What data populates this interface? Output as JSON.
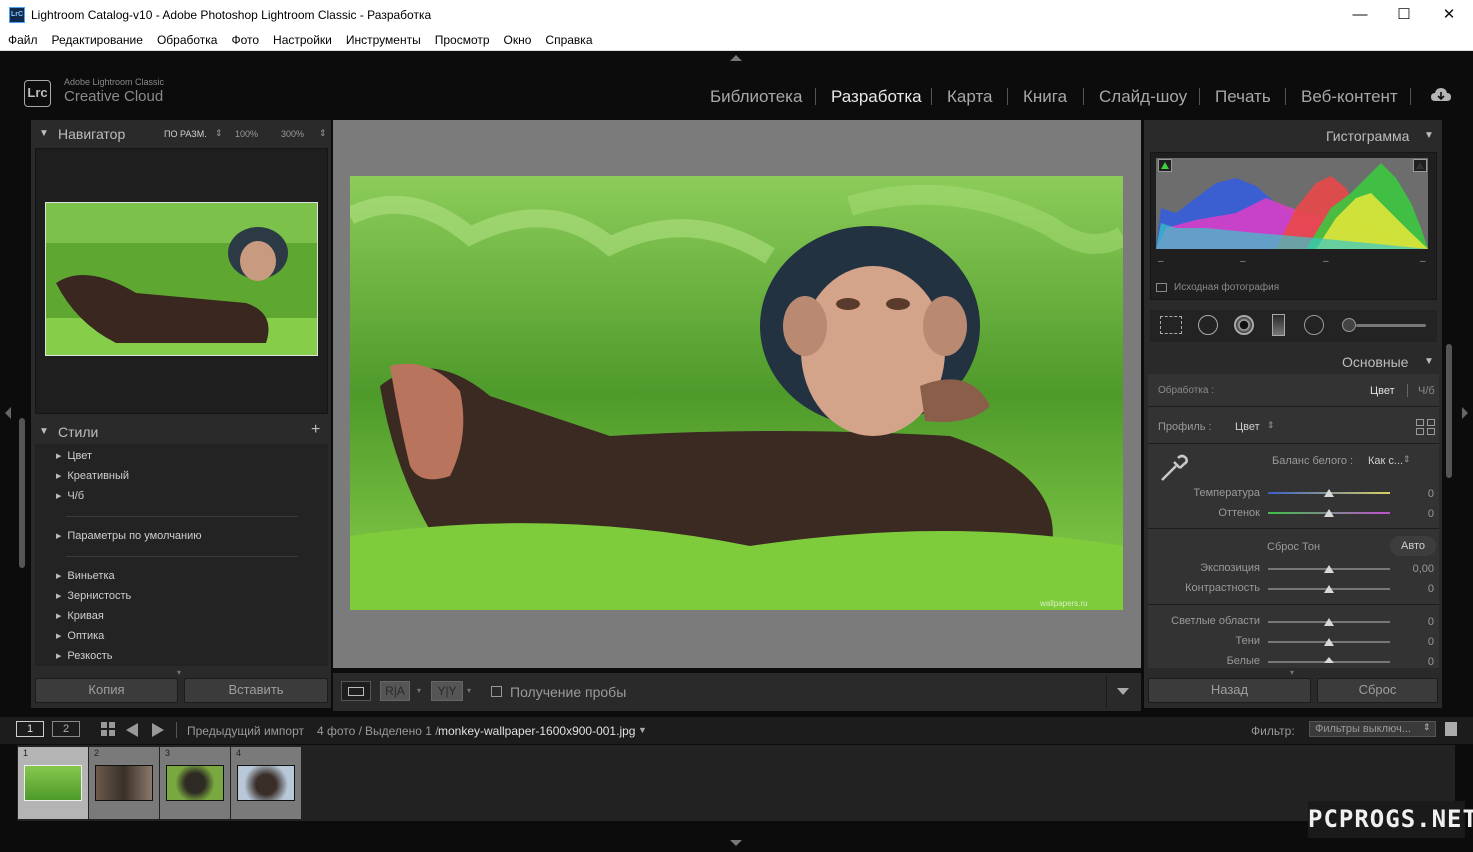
{
  "window": {
    "title": "Lightroom Catalog-v10 - Adobe Photoshop Lightroom Classic - Разработка",
    "app_icon_text": "LrC",
    "minimize_glyph": "—",
    "maximize_glyph": "☐",
    "close_glyph": "✕"
  },
  "menu": [
    "Файл",
    "Редактирование",
    "Обработка",
    "Фото",
    "Настройки",
    "Инструменты",
    "Просмотр",
    "Окно",
    "Справка"
  ],
  "brand": {
    "logo": "Lrc",
    "line1": "Adobe Lightroom Classic",
    "line2": "Creative Cloud"
  },
  "modules": {
    "items": [
      "Библиотека",
      "Разработка",
      "Карта",
      "Книга",
      "Слайд-шоу",
      "Печать",
      "Веб-контент"
    ],
    "active": "Разработка"
  },
  "navigator": {
    "title": "Навигатор",
    "fit": "ПО РАЗМ.",
    "zoom1": "100%",
    "zoom2": "300%"
  },
  "styles": {
    "title": "Стили",
    "group1": [
      "Цвет",
      "Креативный",
      "Ч/б"
    ],
    "group2": [
      "Параметры по умолчанию"
    ],
    "group3": [
      "Виньетка",
      "Зернистость",
      "Кривая",
      "Оптика",
      "Резкость"
    ]
  },
  "left_buttons": {
    "copy": "Копия",
    "paste": "Вставить"
  },
  "toolbar": {
    "soft_proof": "Получение пробы",
    "ra": "R|A",
    "yy": "Y|Y"
  },
  "photo": {
    "watermark": "wallpapers.ru"
  },
  "histogram": {
    "title": "Гистограмма",
    "original_photo": "Исходная фотография",
    "ticks": [
      "–",
      "–",
      "–",
      "–"
    ]
  },
  "basic": {
    "title": "Основные",
    "treatment_label": "Обработка :",
    "treatment_color": "Цвет",
    "treatment_bw": "Ч/б",
    "profile_label": "Профиль :",
    "profile_value": "Цвет",
    "wb_label": "Баланс белого :",
    "wb_value": "Как с...",
    "tone_label": "Сброс Тон",
    "auto_label": "Авто",
    "sliders": [
      {
        "label": "Температура",
        "value": "0",
        "pos": 0.5
      },
      {
        "label": "Оттенок",
        "value": "0",
        "pos": 0.5
      },
      {
        "label": "Экспозиция",
        "value": "0,00",
        "pos": 0.5
      },
      {
        "label": "Контрастность",
        "value": "0",
        "pos": 0.5
      },
      {
        "label": "Светлые области",
        "value": "0",
        "pos": 0.5
      },
      {
        "label": "Тени",
        "value": "0",
        "pos": 0.5
      },
      {
        "label": "Белые",
        "value": "0",
        "pos": 0.5
      }
    ]
  },
  "right_buttons": {
    "previous": "Назад",
    "reset": "Сброс"
  },
  "filmstrip_bar": {
    "screen1": "1",
    "screen2": "2",
    "source": "Предыдущий импорт",
    "count": "4 фото /",
    "selected": "Выделено 1 /",
    "filename": "monkey-wallpaper-1600x900-001.jpg",
    "filter_label": "Фильтр:",
    "filter_value": "Фильтры выключ..."
  },
  "filmstrip": [
    {
      "num": "1",
      "selected": true
    },
    {
      "num": "2",
      "selected": false
    },
    {
      "num": "3",
      "selected": false
    },
    {
      "num": "4",
      "selected": false
    }
  ],
  "watermark_site": "PCPROGS.NET",
  "colors": {
    "accent": "#e8e8e8",
    "panel": "#2a2a2a",
    "canvas": "#7b7b7b"
  }
}
